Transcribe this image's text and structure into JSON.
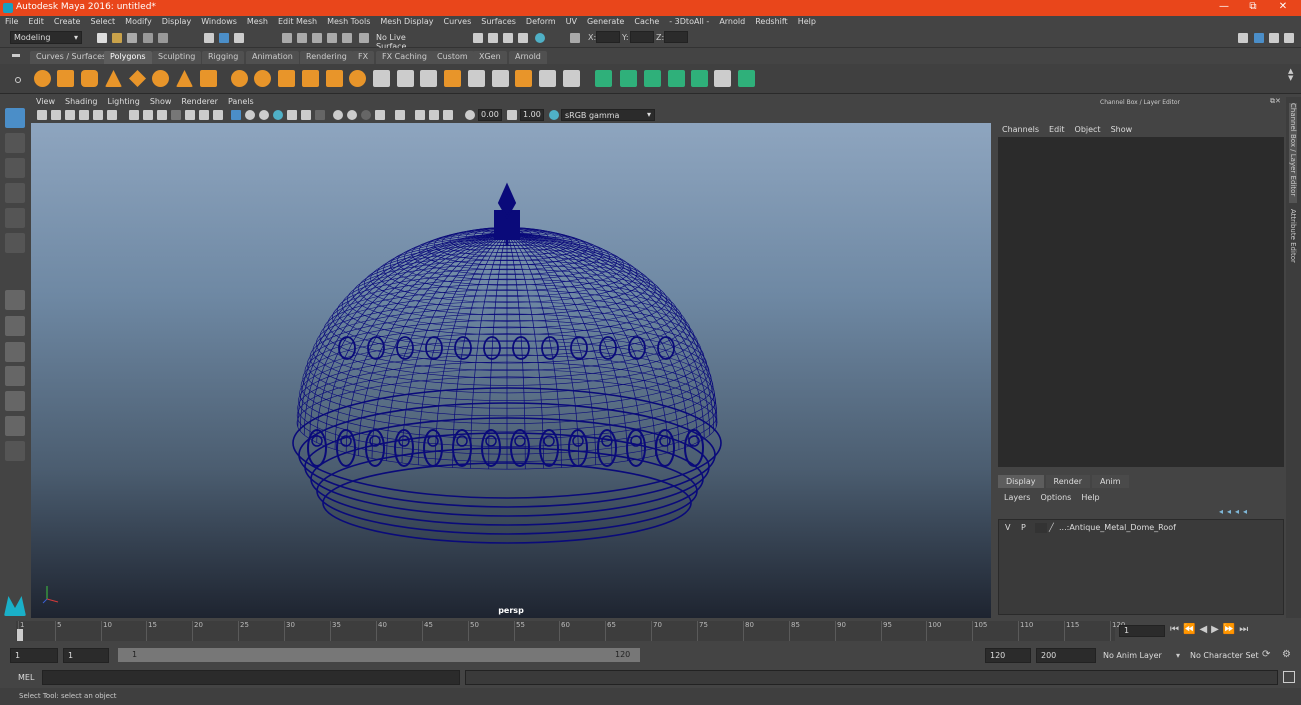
{
  "titlebar": {
    "title": "Autodesk Maya 2016: untitled*",
    "minimize": "—",
    "restore": "⧉",
    "close": "✕"
  },
  "menus": [
    "File",
    "Edit",
    "Create",
    "Select",
    "Modify",
    "Display",
    "Windows",
    "Mesh",
    "Edit Mesh",
    "Mesh Tools",
    "Mesh Display",
    "Curves",
    "Surfaces",
    "Deform",
    "UV",
    "Generate",
    "Cache",
    "- 3DtoAll -",
    "Arnold",
    "Redshift",
    "Help"
  ],
  "statusline": {
    "mode": "Modeling",
    "live_surface": "No Live Surface",
    "x_label": "X:",
    "y_label": "Y:",
    "z_label": "Z:"
  },
  "shelf_tabs": [
    "Curves / Surfaces",
    "Polygons",
    "Sculpting",
    "Rigging",
    "Animation",
    "Rendering",
    "FX",
    "FX Caching",
    "Custom",
    "XGen",
    "Arnold"
  ],
  "shelf_active": "Polygons",
  "viewport_menu": [
    "View",
    "Shading",
    "Lighting",
    "Show",
    "Renderer",
    "Panels"
  ],
  "viewport_toolbar": {
    "exposure": "0.00",
    "gamma": "1.00",
    "colorspace": "sRGB gamma"
  },
  "viewport": {
    "camera_label": "persp",
    "wire_color": "#0a0a7a"
  },
  "channel_box": {
    "header": "Channel Box / Layer Editor",
    "menus": [
      "Channels",
      "Edit",
      "Object",
      "Show"
    ]
  },
  "layer_editor": {
    "tabs": [
      "Display",
      "Render",
      "Anim"
    ],
    "active_tab": "Display",
    "menus": [
      "Layers",
      "Options",
      "Help"
    ],
    "layers": [
      {
        "v": "V",
        "p": "P",
        "name": "...:Antique_Metal_Dome_Roof"
      }
    ]
  },
  "side_tabs": [
    "Channel Box / Layer Editor",
    "Attribute Editor"
  ],
  "timeline": {
    "ticks": [
      1,
      5,
      10,
      15,
      20,
      25,
      30,
      35,
      40,
      45,
      50,
      55,
      60,
      65,
      70,
      75,
      80,
      85,
      90,
      95,
      100,
      105,
      110,
      115,
      120
    ],
    "current_frame": "1"
  },
  "range": {
    "start": "1",
    "inner_start": "1",
    "slider_start": "1",
    "slider_end": "120",
    "end": "120",
    "outer_end": "200",
    "anim_layer": "No Anim Layer",
    "char_set": "No Character Set"
  },
  "cmdline": {
    "label": "MEL"
  },
  "helpline": {
    "text": "Select Tool: select an object"
  }
}
